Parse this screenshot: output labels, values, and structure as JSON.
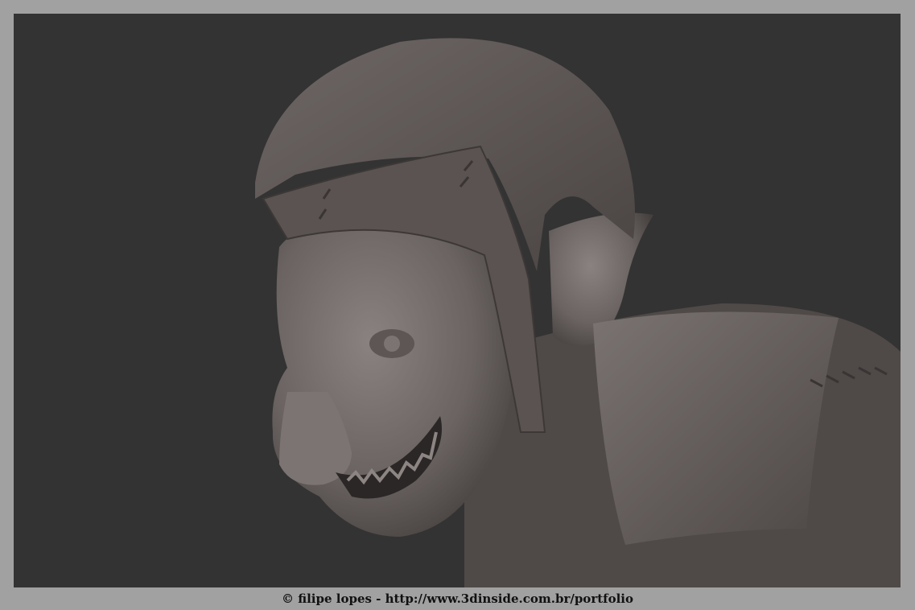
{
  "caption": "© filipe lopes - http://www.3dinside.com.br/portfolio",
  "colors": {
    "frame": "#a1a1a1",
    "background": "#333333",
    "clay": "#6b6462"
  }
}
